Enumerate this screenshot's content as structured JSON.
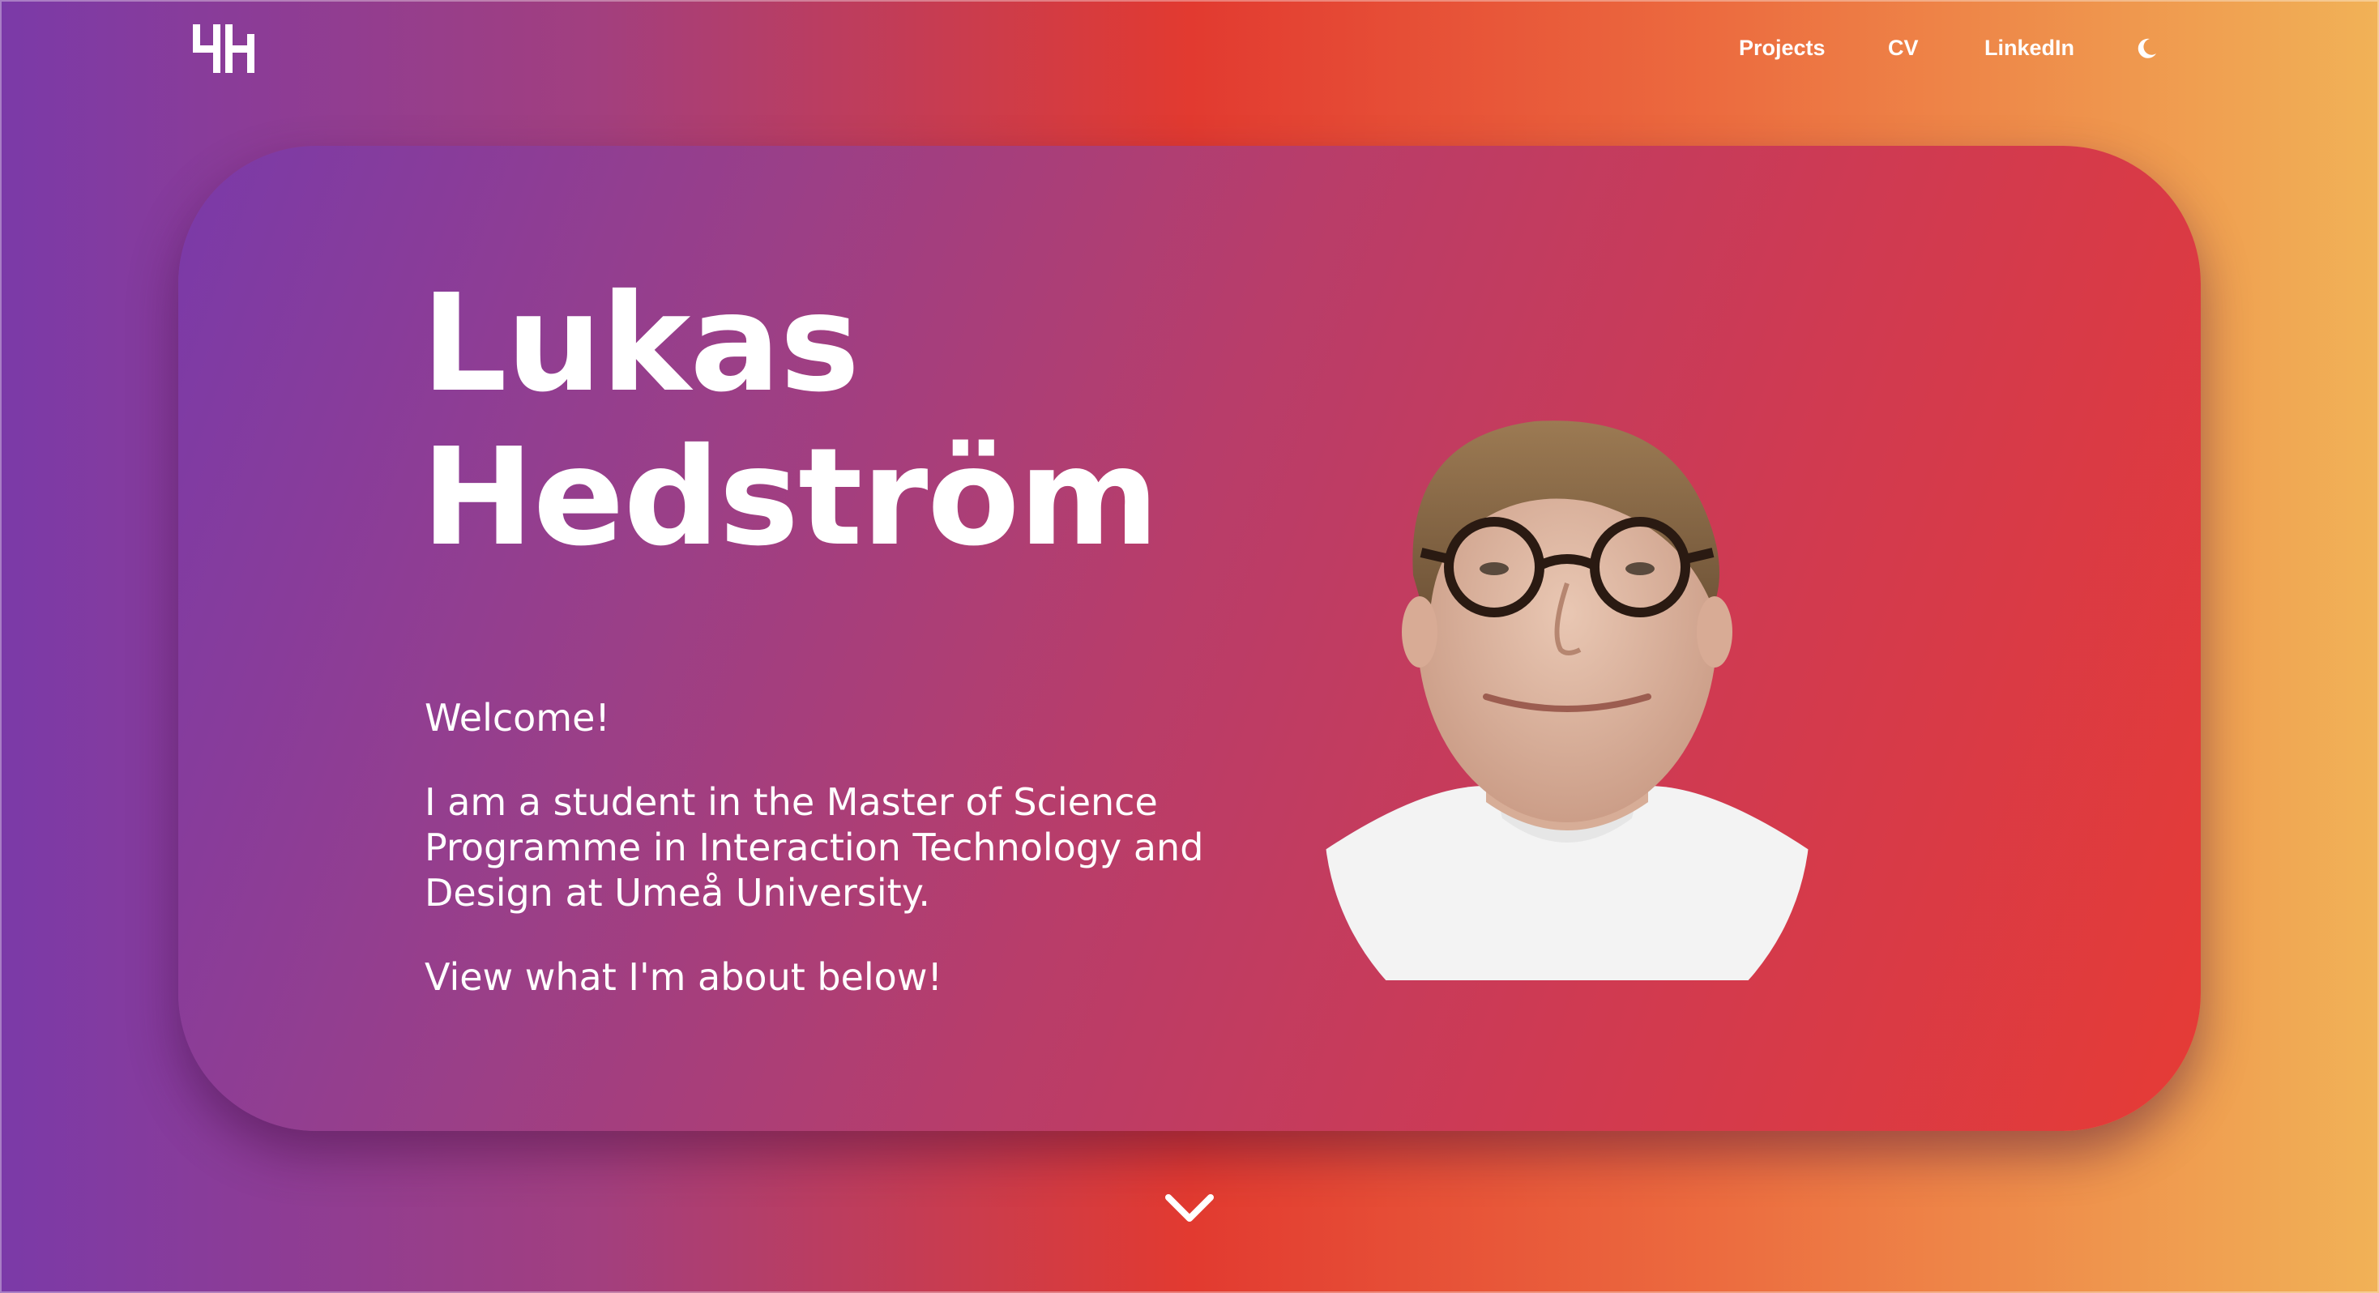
{
  "nav": {
    "logo_text": "LH",
    "links": [
      {
        "label": "Projects"
      },
      {
        "label": "CV"
      },
      {
        "label": "LinkedIn"
      }
    ],
    "theme_toggle_icon": "moon-icon"
  },
  "hero": {
    "first_name": "Lukas",
    "last_name": "Hedström",
    "welcome": "Welcome!",
    "study": "I am a student in the Master of Science Programme in Interaction Technology and Design at Umeå University.",
    "cta": "View what I'm about below!",
    "portrait_icon": "portrait-photo"
  },
  "scroll": {
    "icon": "chevron-down-icon"
  },
  "colors": {
    "gradient_start": "#7b3aa8",
    "gradient_mid": "#e23a30",
    "gradient_end": "#f1b257",
    "text": "#ffffff"
  }
}
